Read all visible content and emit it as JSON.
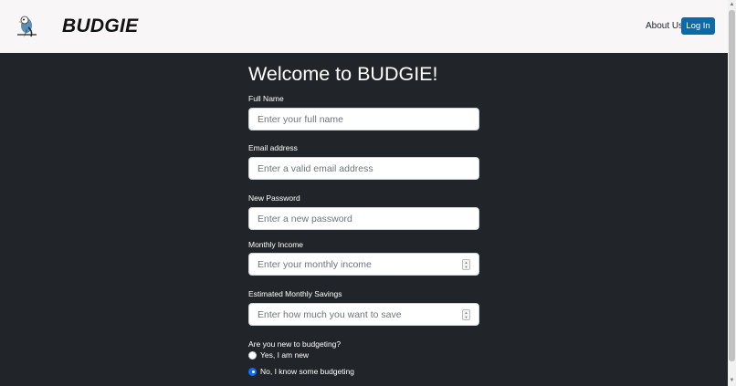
{
  "navbar": {
    "brand": "BUDGIE",
    "about_label": "About Us",
    "login_label": "Log In"
  },
  "form": {
    "title": "Welcome to BUDGIE!",
    "full_name": {
      "label": "Full Name",
      "placeholder": "Enter your full name"
    },
    "email": {
      "label": "Email address",
      "placeholder": "Enter a valid email address"
    },
    "password": {
      "label": "New Password",
      "placeholder": "Enter a new password"
    },
    "income": {
      "label": "Monthly Income",
      "placeholder": "Enter your monthly income"
    },
    "savings": {
      "label": "Estimated Monthly Savings",
      "placeholder": "Enter how much you want to save"
    },
    "budgeting": {
      "question": "Are you new to budgeting?",
      "options": [
        {
          "label": "Yes, I am new",
          "checked": false
        },
        {
          "label": "No, I know some budgeting",
          "checked": true
        }
      ]
    }
  },
  "icons": {
    "logo": "budgie-bird-logo",
    "spinner": "number-spinner-icon"
  },
  "colors": {
    "background": "#212529",
    "navbar": "#f8f6f7",
    "login_button": "#0d6aa8",
    "radio_checked": "#0d6efd"
  }
}
